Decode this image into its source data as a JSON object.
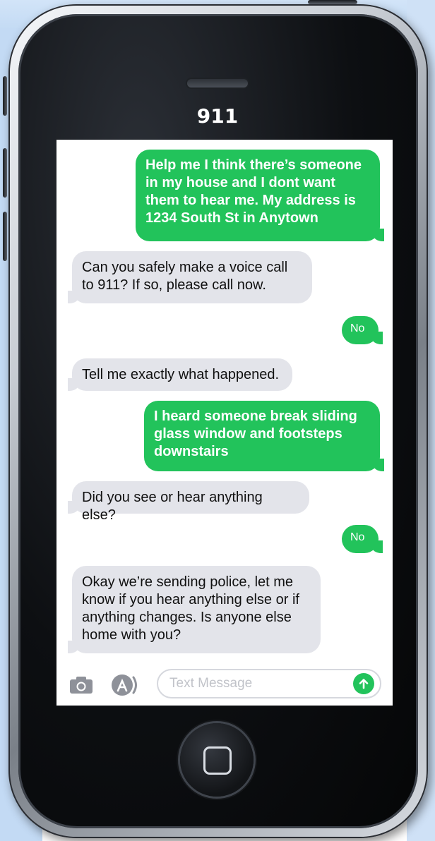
{
  "contact": {
    "title": "911"
  },
  "messages": [
    {
      "direction": "out",
      "text": "Help me I think there’s someone in my house and I dont want them to hear me. My address is 1234 South St in Anytown"
    },
    {
      "direction": "in",
      "text": "Can you safely make a voice call to 911? If so, please call now."
    },
    {
      "direction": "out",
      "text": "No"
    },
    {
      "direction": "in",
      "text": "Tell me exactly what happened."
    },
    {
      "direction": "out",
      "text": "I heard someone break sliding glass window and footsteps downstairs"
    },
    {
      "direction": "in",
      "text": "Did you see or hear anything else?"
    },
    {
      "direction": "out",
      "text": "No"
    },
    {
      "direction": "in",
      "text": "Okay we’re sending police, let me know if you hear anything else or if anything changes. Is anyone else home with you?"
    }
  ],
  "composer": {
    "placeholder": "Text Message",
    "camera_icon": "camera-icon",
    "apps_icon": "app-store-icon",
    "send_icon": "arrow-up-icon"
  },
  "colors": {
    "outgoing_bubble": "#22c35b",
    "incoming_bubble": "#e3e4ea",
    "screen_background": "#ffffff",
    "background_accent": "#c3daf4"
  }
}
